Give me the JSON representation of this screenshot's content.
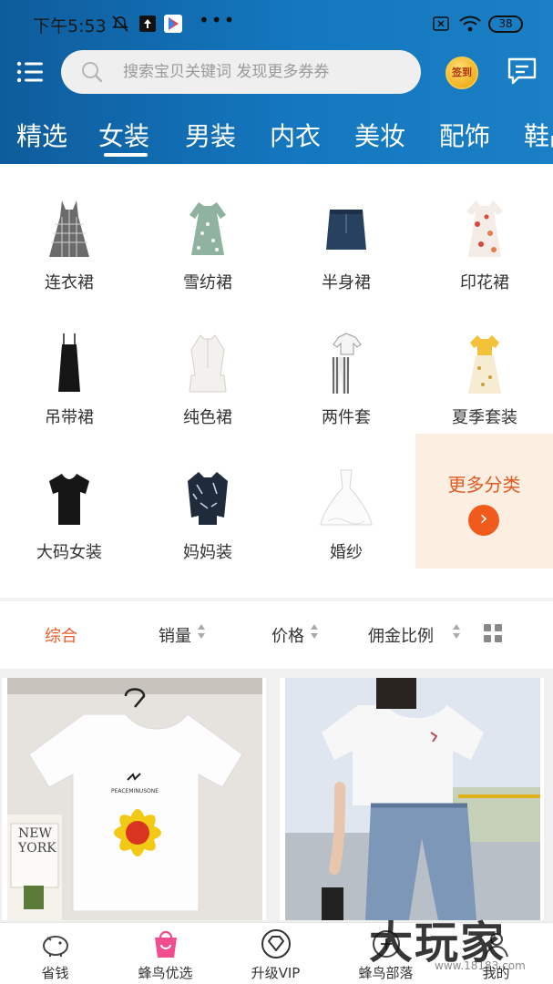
{
  "status_bar": {
    "time": "下午5:53",
    "battery": "38"
  },
  "header": {
    "search_placeholder": "搜索宝贝关键词 发现更多券券",
    "signin_label": "签到"
  },
  "tabs": [
    "精选",
    "女装",
    "男装",
    "内衣",
    "美妆",
    "配饰",
    "鞋品"
  ],
  "active_tab": "女装",
  "categories": [
    {
      "label": "连衣裙",
      "icon": "plaid-dress-icon"
    },
    {
      "label": "雪纺裙",
      "icon": "floral-dress-icon"
    },
    {
      "label": "半身裙",
      "icon": "denim-skirt-icon"
    },
    {
      "label": "印花裙",
      "icon": "print-dress-icon"
    },
    {
      "label": "吊带裙",
      "icon": "slip-dress-icon"
    },
    {
      "label": "纯色裙",
      "icon": "white-dress-icon"
    },
    {
      "label": "两件套",
      "icon": "two-piece-icon"
    },
    {
      "label": "夏季套装",
      "icon": "summer-set-icon"
    },
    {
      "label": "大码女装",
      "icon": "black-tshirt-icon"
    },
    {
      "label": "妈妈装",
      "icon": "print-blouse-icon"
    },
    {
      "label": "婚纱",
      "icon": "wedding-dress-icon"
    }
  ],
  "more_categories": {
    "label": "更多分类"
  },
  "sort_bar": {
    "items": [
      "综合",
      "销量",
      "价格",
      "佣金比例"
    ],
    "active": "综合"
  },
  "products": [
    {
      "name": "white-sunflower-tshirt"
    },
    {
      "name": "white-tshirt-jeans"
    }
  ],
  "bottom_nav": [
    "省钱",
    "蜂鸟优选",
    "升级VIP",
    "蜂鸟部落",
    "我的"
  ],
  "watermark": {
    "text": "大玩家",
    "url": "www.18183.com"
  },
  "colors": {
    "header_blue": "#1478c0",
    "accent_orange": "#ea5b2b",
    "more_bg": "#fdeee2"
  }
}
